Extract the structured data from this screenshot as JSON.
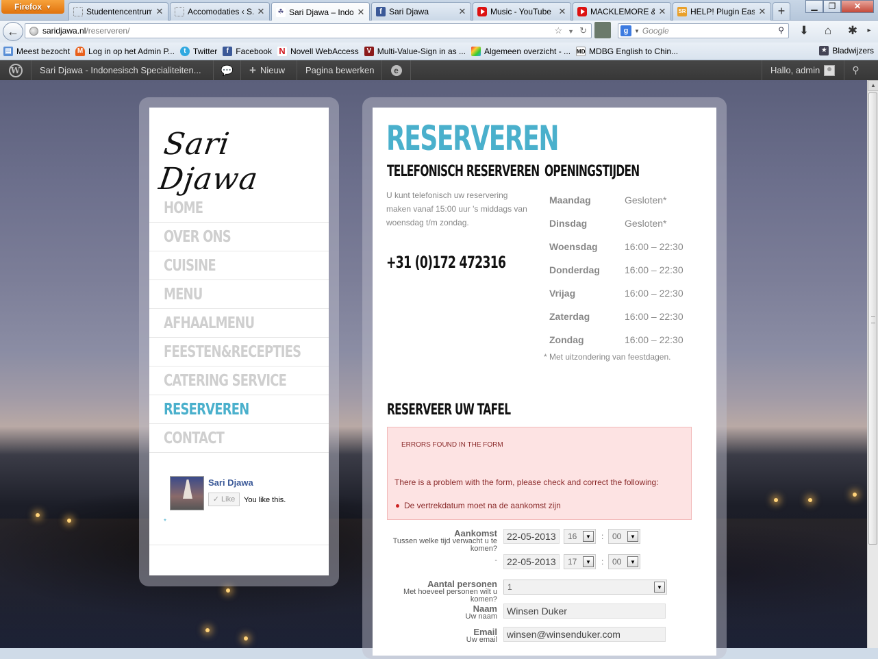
{
  "browser": {
    "firefox_label": "Firefox",
    "tabs": [
      {
        "label": "Studentencentrum",
        "icon": "page-icon"
      },
      {
        "label": "Accomodaties ‹ S...",
        "icon": "page-icon"
      },
      {
        "label": "Sari Djawa – Indo...",
        "icon": "site-icon",
        "active": true
      },
      {
        "label": "Sari Djawa",
        "icon": "facebook-icon"
      },
      {
        "label": "Music - YouTube",
        "icon": "youtube-icon"
      },
      {
        "label": "MACKLEMORE &...",
        "icon": "youtube-icon"
      },
      {
        "label": "HELP! Plugin Easy...",
        "icon": "support-icon"
      }
    ],
    "new_tab": "+",
    "url_domain": "saridjawa.nl",
    "url_path": "/reserveren/",
    "search_placeholder": "Google",
    "bookmarks": [
      {
        "label": "Meest bezocht"
      },
      {
        "label": "Log in op het Admin P..."
      },
      {
        "label": "Twitter"
      },
      {
        "label": "Facebook"
      },
      {
        "label": "Novell WebAccess"
      },
      {
        "label": "Multi-Value-Sign in as ..."
      },
      {
        "label": "Algemeen overzicht - ..."
      },
      {
        "label": "MDBG English to Chin..."
      }
    ],
    "bookmarks_menu": "Bladwijzers"
  },
  "adminbar": {
    "site_name": "Sari Djawa - Indonesisch Specialiteiten...",
    "new_label": "Nieuw",
    "edit_label": "Pagina bewerken",
    "greeting": "Hallo, admin"
  },
  "sidebar": {
    "logo": "Sari Djawa",
    "menu": [
      "Home",
      "Over ons",
      "Cuisine",
      "Menu",
      "Afhaalmenu",
      "Feesten&Recepties",
      "Catering Service",
      "Reserveren",
      "Contact"
    ],
    "active_menu": "Reserveren",
    "fb": {
      "name": "Sari Djawa",
      "like": "Like",
      "you_like": "You like this."
    },
    "asterisk": "*"
  },
  "content": {
    "title": "Reserveren",
    "tel": {
      "heading": "Telefonisch reserveren",
      "text": "U kunt telefonisch uw reservering maken vanaf 15:00 uur 's middags van woensdag t/m zondag.",
      "number": "+31 (0)172 472316"
    },
    "hours": {
      "heading": "Openingstijden",
      "rows": [
        {
          "day": "Maandag",
          "time": "Gesloten*"
        },
        {
          "day": "Dinsdag",
          "time": "Gesloten*"
        },
        {
          "day": "Woensdag",
          "time": "16:00 – 22:30"
        },
        {
          "day": "Donderdag",
          "time": "16:00 – 22:30"
        },
        {
          "day": "Vrijag",
          "time": "16:00 – 22:30"
        },
        {
          "day": "Zaterdag",
          "time": "16:00 – 22:30"
        },
        {
          "day": "Zondag",
          "time": "16:00 – 22:30"
        }
      ],
      "note": "* Met uitzondering van feestdagen."
    },
    "form": {
      "heading": "Reserveer uw tafel",
      "error_title": "Errors found in the form",
      "error_msg": "There is a problem with the form, please check and correct the following:",
      "error_item": "De vertrekdatum moet na de aankomst zijn",
      "arrival_label": "Aankomst",
      "arrival_help": "Tussen welke tijd verwacht u te komen?",
      "arrival_date": "22-05-2013",
      "arrival_hour": "16",
      "arrival_min": "00",
      "dash": "-",
      "depart_date": "22-05-2013",
      "depart_hour": "17",
      "depart_min": "00",
      "persons_label": "Aantal personen",
      "persons_help": "Met hoeveel personen wilt u komen?",
      "persons_value": "1",
      "name_label": "Naam",
      "name_help": "Uw naam",
      "name_value": "Winsen Duker",
      "email_label": "Email",
      "email_help": "Uw email",
      "email_value": "winsen@winsenduker.com",
      "colon": ":"
    }
  }
}
